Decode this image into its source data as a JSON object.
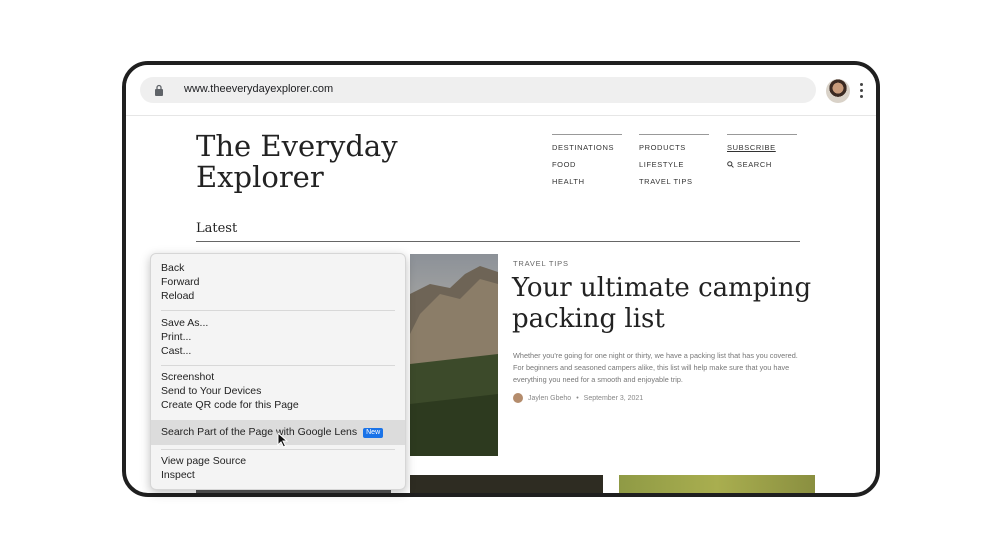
{
  "browser": {
    "url": "www.theeverydayexplorer.com"
  },
  "site": {
    "title_line1": "The Everyday",
    "title_line2": "Explorer",
    "nav": {
      "col1": [
        "DESTINATIONS",
        "FOOD",
        "HEALTH"
      ],
      "col2": [
        "PRODUCTS",
        "LIFESTYLE",
        "TRAVEL TIPS"
      ],
      "subscribe": "SUBSCRIBE",
      "search": "SEARCH"
    },
    "section": "Latest"
  },
  "article": {
    "tag": "TRAVEL TIPS",
    "headline": "Your ultimate camping packing list",
    "excerpt": "Whether you're going for one night or thirty, we have a packing list that has you covered. For beginners and seasoned campers alike, this list will help make sure that you have everything you need for a smooth and enjoyable trip.",
    "author": "Jaylen Gbeho",
    "date": "September 3, 2021"
  },
  "context_menu": {
    "back": "Back",
    "forward": "Forward",
    "reload": "Reload",
    "save_as": "Save As...",
    "print": "Print...",
    "cast": "Cast...",
    "screenshot": "Screenshot",
    "send_devices": "Send to Your Devices",
    "qr": "Create QR code for this Page",
    "lens": "Search Part of the Page with Google Lens",
    "lens_badge": "New",
    "view_source": "View page Source",
    "inspect": "Inspect"
  },
  "colors": {
    "accent": "#1a73e8",
    "menu_bg": "#f4f4f4",
    "highlight": "#dcdcdc"
  },
  "icons": [
    "lock-icon",
    "kebab-menu-icon",
    "search-icon",
    "cursor-icon"
  ]
}
